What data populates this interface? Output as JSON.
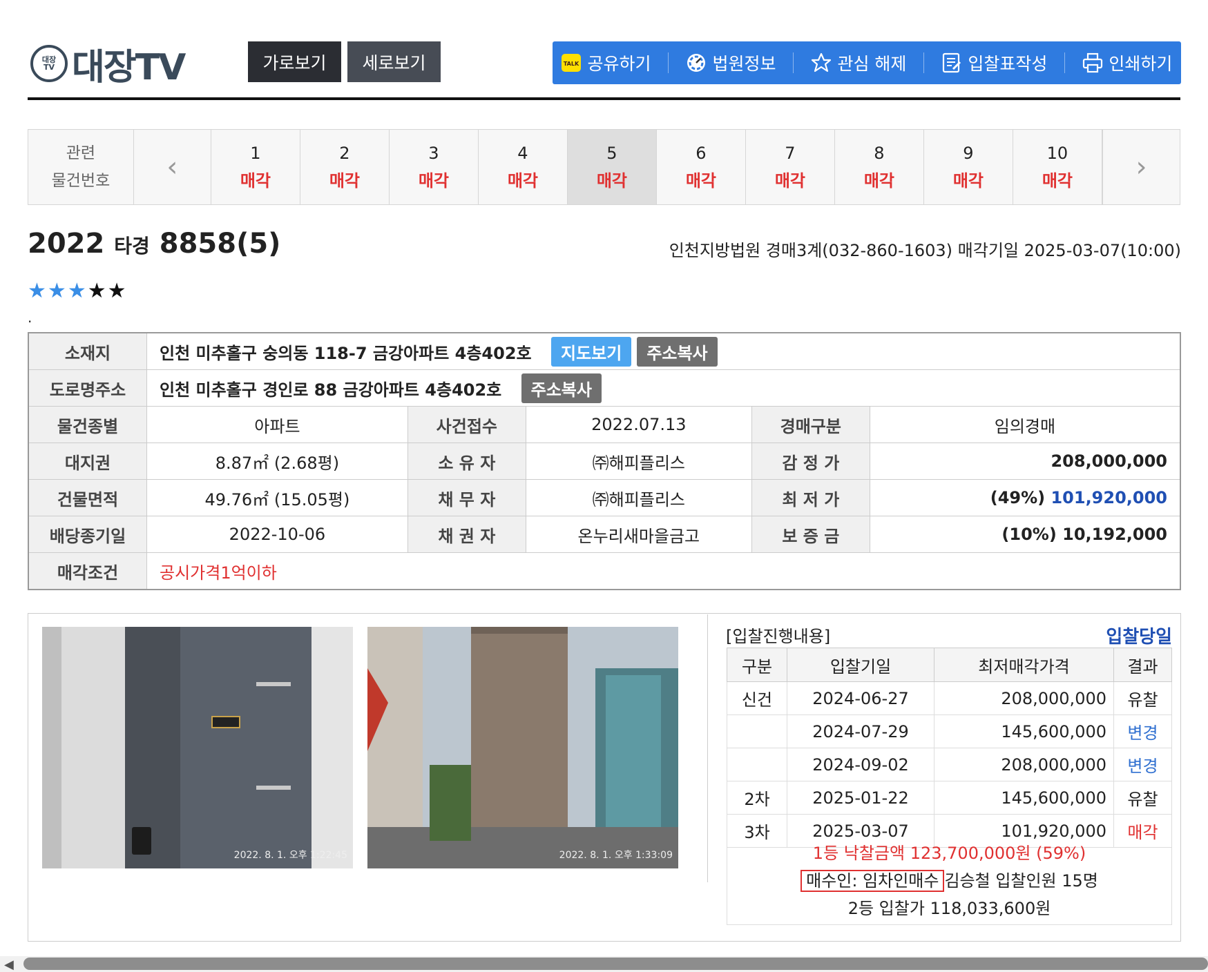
{
  "header": {
    "logo_seal": "대장TV",
    "logo_text": "대장TV",
    "view_buttons": [
      "가로보기",
      "세로보기"
    ],
    "toolbar": [
      {
        "label": "공유하기",
        "icon": "kakao-talk-icon"
      },
      {
        "label": "법원정보",
        "icon": "court-gauge-icon"
      },
      {
        "label": "관심 해제",
        "icon": "star-outline-icon"
      },
      {
        "label": "입찰표작성",
        "icon": "bid-form-icon"
      },
      {
        "label": "인쇄하기",
        "icon": "printer-icon"
      }
    ],
    "toolbar_color": "#2f7be0"
  },
  "related_nav": {
    "label_line1": "관련",
    "label_line2": "물건번호",
    "prev": "‹",
    "next": "›",
    "items": [
      {
        "num": "1",
        "status": "매각"
      },
      {
        "num": "2",
        "status": "매각"
      },
      {
        "num": "3",
        "status": "매각"
      },
      {
        "num": "4",
        "status": "매각"
      },
      {
        "num": "5",
        "status": "매각"
      },
      {
        "num": "6",
        "status": "매각"
      },
      {
        "num": "7",
        "status": "매각"
      },
      {
        "num": "8",
        "status": "매각"
      },
      {
        "num": "9",
        "status": "매각"
      },
      {
        "num": "10",
        "status": "매각"
      }
    ],
    "active_index": 4
  },
  "case": {
    "year": "2022",
    "type": "타경",
    "number": "8858(5)",
    "court_info": "인천지방법원 경매3계(032-860-1603) 매각기일 2025-03-07(10:00)",
    "stars_total": 5,
    "stars_on": 3,
    "dot": "."
  },
  "info": {
    "location_label": "소재지",
    "location": "인천 미추홀구 숭의동 118-7 금강아파트 4층402호",
    "map_button": "지도보기",
    "copy_button": "주소복사",
    "road_label": "도로명주소",
    "road": "인천 미추홀구 경인로 88 금강아파트 4층402호",
    "rows": [
      [
        {
          "h": "물건종별",
          "v": "아파트"
        },
        {
          "h": "사건접수",
          "v": "2022.07.13"
        },
        {
          "h": "경매구분",
          "v": "임의경매"
        }
      ],
      [
        {
          "h": "대지권",
          "v": "8.87㎡ (2.68평)"
        },
        {
          "h": "소 유 자",
          "v": "㈜해피플리스"
        },
        {
          "h": "감 정 가",
          "v": "208,000,000"
        }
      ],
      [
        {
          "h": "건물면적",
          "v": "49.76㎡ (15.05평)"
        },
        {
          "h": "채 무 자",
          "v": "㈜해피플리스"
        },
        {
          "h": "최 저 가",
          "pct": "(49%)",
          "v": "101,920,000"
        }
      ],
      [
        {
          "h": "배당종기일",
          "v": "2022-10-06"
        },
        {
          "h": "채 권 자",
          "v": "온누리새마을금고"
        },
        {
          "h": "보 증 금",
          "v": "(10%) 10,192,000"
        }
      ]
    ],
    "condition_label": "매각조건",
    "condition": "공시가격1억이하"
  },
  "photos": [
    {
      "name": "door-photo",
      "stamp": "2022. 8. 1. 오후 1:22:45"
    },
    {
      "name": "building-photo",
      "stamp": "2022. 8. 1. 오후 1:33:09"
    }
  ],
  "bidding": {
    "title": "[입찰진행내용]",
    "day_label": "입찰당일",
    "columns": [
      "구분",
      "입찰기일",
      "최저매각가격",
      "결과"
    ],
    "rows": [
      {
        "round": "신건",
        "date": "2024-06-27",
        "price": "208,000,000",
        "result": "유찰",
        "result_color": "#222222"
      },
      {
        "round": "",
        "date": "2024-07-29",
        "price": "145,600,000",
        "result": "변경",
        "result_color": "#2f6fd0"
      },
      {
        "round": "",
        "date": "2024-09-02",
        "price": "208,000,000",
        "result": "변경",
        "result_color": "#2f6fd0"
      },
      {
        "round": "2차",
        "date": "2025-01-22",
        "price": "145,600,000",
        "result": "유찰",
        "result_color": "#222222"
      },
      {
        "round": "3차",
        "date": "2025-03-07",
        "price": "101,920,000",
        "result": "매각",
        "result_color": "#e03030"
      }
    ],
    "winning_bid": "1등 낙찰금액 123,700,000원 (59%)",
    "buyer_label": "매수인: 임차인매수",
    "buyer_rest": "김승철 입찰인원 15명",
    "second_bid": "2등 입찰가 118,033,600원"
  }
}
